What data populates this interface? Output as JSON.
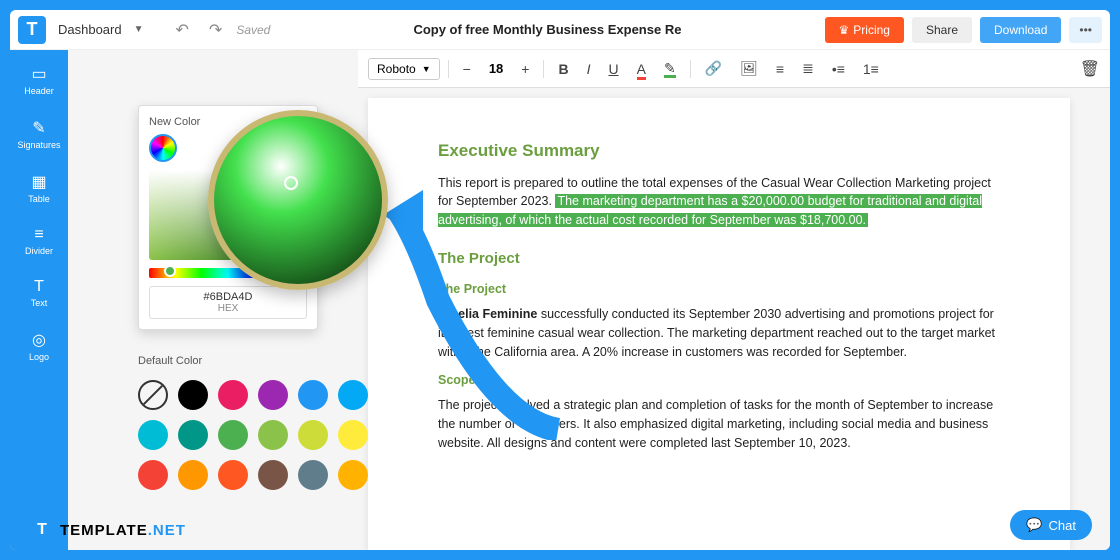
{
  "topbar": {
    "dashboard": "Dashboard",
    "saved": "Saved",
    "title": "Copy of free Monthly Business Expense Re",
    "pricing": "Pricing",
    "share": "Share",
    "download": "Download"
  },
  "sidebar": {
    "items": [
      {
        "label": "Header"
      },
      {
        "label": "Signatures"
      },
      {
        "label": "Table"
      },
      {
        "label": "Divider"
      },
      {
        "label": "Text"
      },
      {
        "label": "Logo"
      }
    ]
  },
  "toolbar": {
    "font": "Roboto",
    "size": "18"
  },
  "colorpicker": {
    "new": "New Color",
    "hex": "#6BDA4D",
    "hexlabel": "HEX",
    "default": "Default Color"
  },
  "swatches": [
    "#000",
    "#e91e63",
    "#9c27b0",
    "#2196f3",
    "#03a9f4",
    "#00bcd4",
    "#009688",
    "#4caf50",
    "#8bc34a",
    "#cddc39",
    "#ffeb3b",
    "#f44336",
    "#ff9800",
    "#ff5722",
    "#795548",
    "#607d8b",
    "#ffb300"
  ],
  "doc": {
    "h1": "Executive Summary",
    "p1a": "This report is prepared to outline the total expenses of the Casual Wear Collection Marketing project for September 2023. ",
    "p1b": "The marketing department has a $20,000.00 budget for traditional and digital advertising, of which the actual cost recorded for September was $18,700.00.",
    "h2": "The Project",
    "h3": "The Project",
    "p2a": "Amelia Feminine",
    "p2b": " successfully conducted its September 2030 advertising and promotions project for its latest feminine casual wear collection. The marketing department reached out to the target market within the California area. A 20% increase in customers was recorded for September.",
    "h4": "Scope",
    "p3": "The project involved a strategic plan and completion of tasks for the month of September to increase the number of customers. It also emphasized digital marketing, including social media and business website. All designs and content were completed last September 10, 2023."
  },
  "brand": {
    "name": "TEMPLATE",
    "suffix": ".NET"
  },
  "chat": "Chat"
}
